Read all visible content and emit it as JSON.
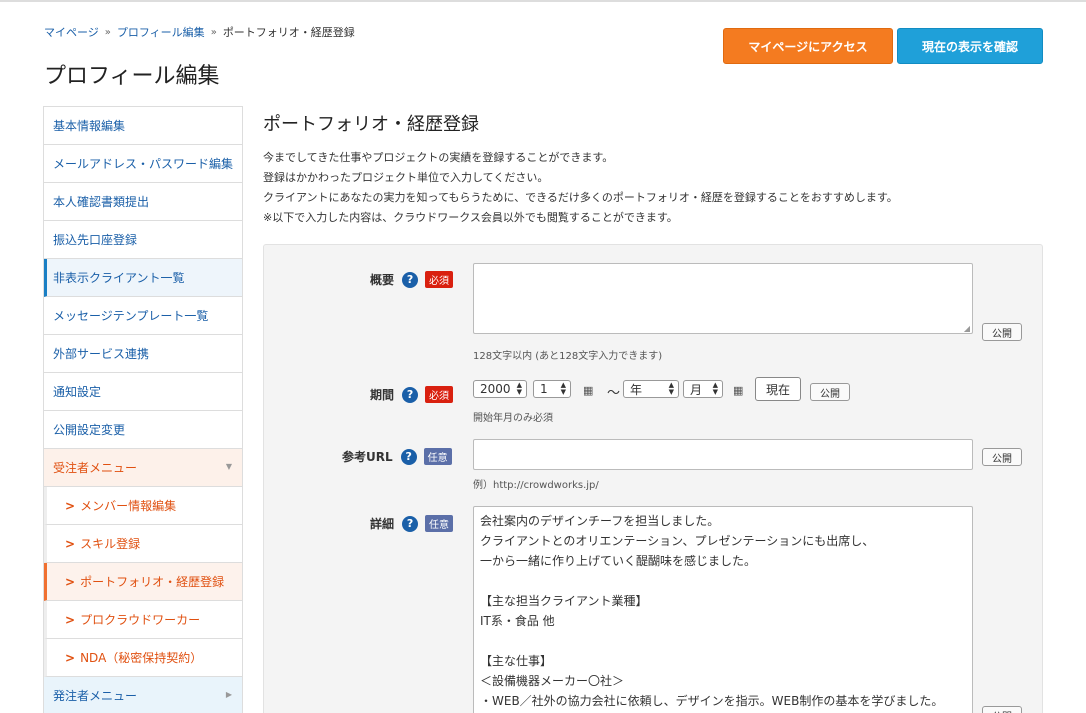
{
  "breadcrumb": {
    "home": "マイページ",
    "profile": "プロフィール編集",
    "current": "ポートフォリオ・経歴登録",
    "sep": "»"
  },
  "page_title": "プロフィール編集",
  "buttons": {
    "mypage": "マイページにアクセス",
    "preview": "現在の表示を確認"
  },
  "sidebar": {
    "items": [
      "基本情報編集",
      "メールアドレス・パスワード編集",
      "本人確認書類提出",
      "振込先口座登録",
      "非表示クライアント一覧",
      "メッセージテンプレート一覧",
      "外部サービス連携",
      "通知設定",
      "公開設定変更"
    ],
    "contractor_menu": "受注者メニュー",
    "sub_items": [
      "メンバー情報編集",
      "スキル登録",
      "ポートフォリオ・経歴登録",
      "プロクラウドワーカー",
      "NDA（秘密保持契約）"
    ],
    "client_menu": "発注者メニュー"
  },
  "section_title": "ポートフォリオ・経歴登録",
  "intro": [
    "今までしてきた仕事やプロジェクトの実績を登録することができます。",
    "登録はかかわったプロジェクト単位で入力してください。",
    "クライアントにあなたの実力を知ってもらうために、できるだけ多くのポートフォリオ・経歴を登録することをおすすめします。",
    "※以下で入力した内容は、クラウドワークス会員以外でも閲覧することができます。"
  ],
  "form": {
    "summary": {
      "label": "概要",
      "badge": "必須",
      "help": "?",
      "note": "128文字以内 (あと128文字入力できます)",
      "value": ""
    },
    "period": {
      "label": "期間",
      "badge": "必須",
      "help": "?",
      "start_year": "2000",
      "start_month": "1",
      "tilde": "〜",
      "end_year": "年",
      "end_month": "月",
      "now_button": "現在",
      "note": "開始年月のみ必須"
    },
    "url": {
      "label": "参考URL",
      "badge": "任意",
      "help": "?",
      "note": "例）http://crowdworks.jp/",
      "value": ""
    },
    "detail": {
      "label": "詳細",
      "badge": "任意",
      "help": "?",
      "text": "会社案内のデザインチーフを担当しました。\nクライアントとのオリエンテーション、プレゼンテーションにも出席し、\n一から一緒に作り上げていく醍醐味を感じました。\n\n【主な担当クライアント業種】\nIT系・食品 他\n\n【主な仕事】\n＜設備機器メーカー〇社＞\n・WEB／社外の協力会社に依頼し、デザインを指示。WEB制作の基本を学びました。"
    },
    "public_label": "公開"
  },
  "icons": {
    "calendar": "calendar-icon",
    "help": "help-icon",
    "chevron": "chevron-right-icon"
  },
  "colors": {
    "accent_orange": "#f47b20",
    "accent_blue": "#1fa0d9",
    "link": "#1a5fa8",
    "required": "#d9200f",
    "optional": "#5b6fa8"
  }
}
